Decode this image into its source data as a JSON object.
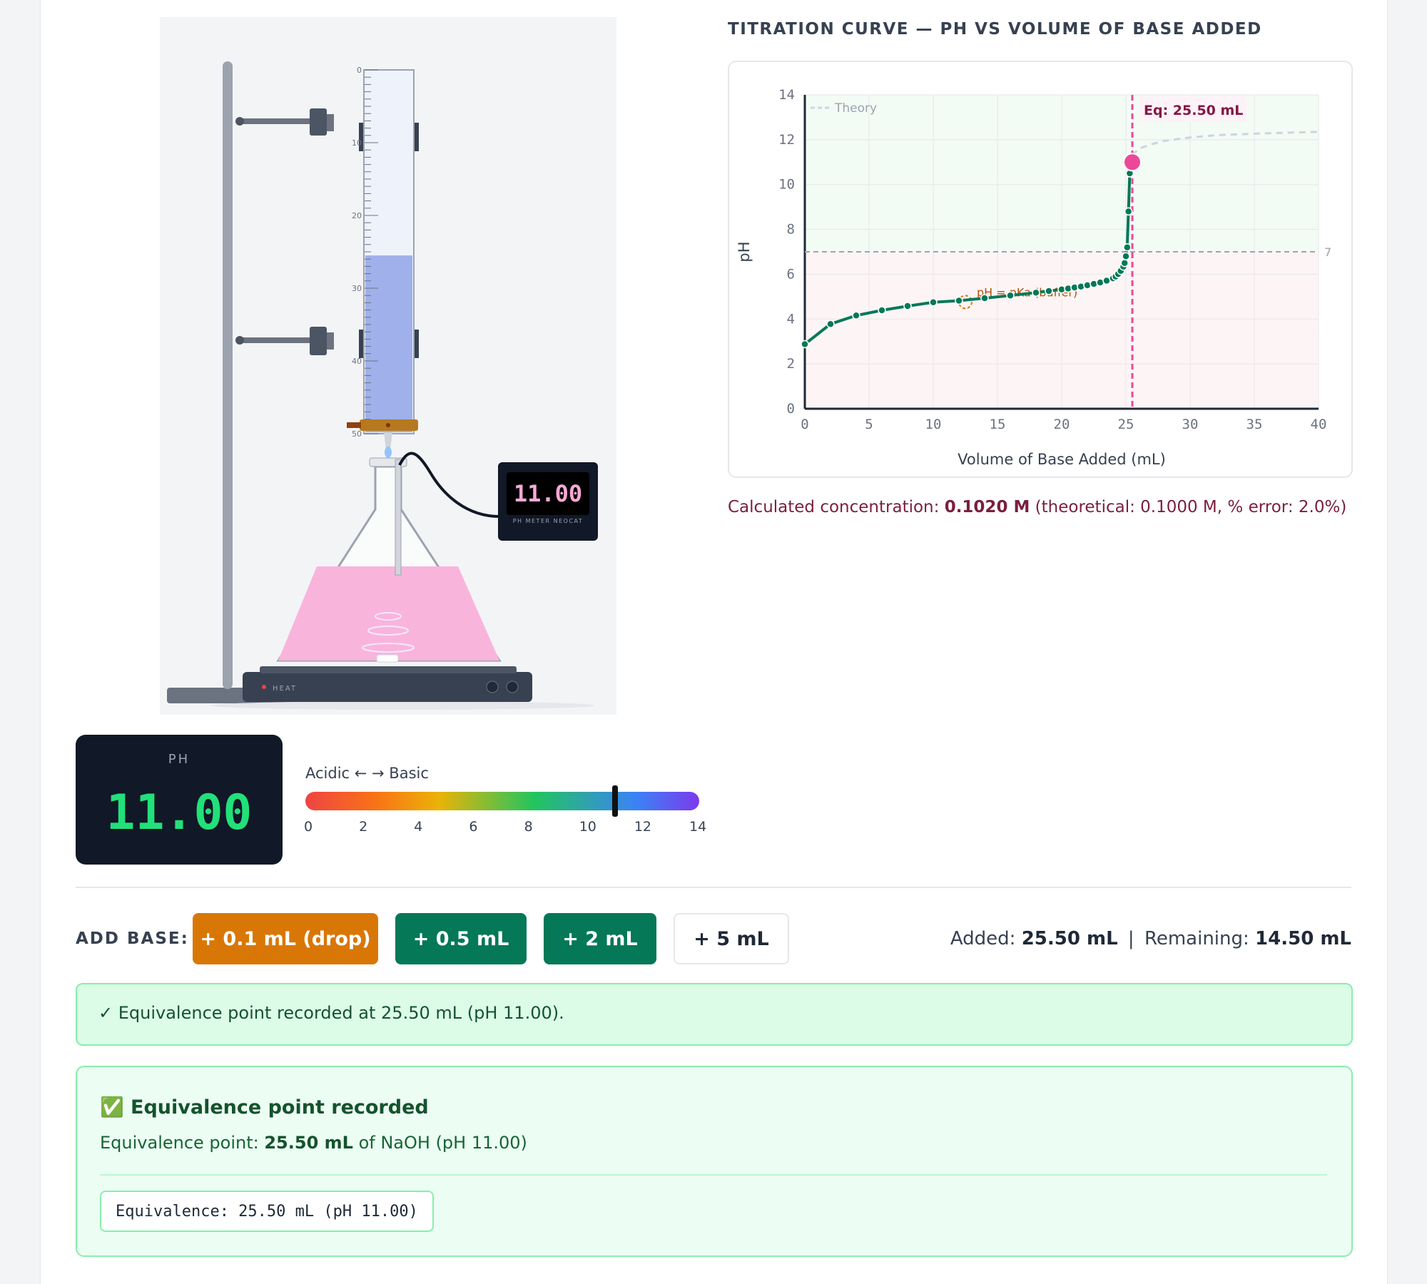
{
  "chart_title": "TITRATION CURVE — PH VS VOLUME OF BASE ADDED",
  "meter": {
    "reading": "11.00",
    "label": "PH METER NEOCAT"
  },
  "hotplate": {
    "label": "HEAT"
  },
  "burette": {
    "ticks": [
      "0",
      "10",
      "20",
      "30",
      "40",
      "50"
    ],
    "level_fraction": 0.51
  },
  "chart_data": {
    "type": "line",
    "xlabel": "Volume of Base Added (mL)",
    "ylabel": "pH",
    "xlim": [
      0,
      40
    ],
    "ylim": [
      0,
      14
    ],
    "xticks": [
      "0",
      "5",
      "10",
      "15",
      "20",
      "25",
      "30",
      "35",
      "40"
    ],
    "yticks": [
      "0",
      "2",
      "4",
      "6",
      "8",
      "10",
      "12",
      "14"
    ],
    "legend": "Theory",
    "reference_line": {
      "value": 7,
      "label": "7"
    },
    "equivalence": {
      "x": 25.5,
      "y": 11.0,
      "label": "Eq: 25.50 mL"
    },
    "half_equivalence": {
      "x": 12.5,
      "y": 4.76,
      "label": "pH = pKa (buffer)"
    },
    "measured": {
      "x": [
        0,
        2,
        4,
        6,
        8,
        10,
        12,
        14,
        16,
        18,
        19,
        20,
        20.5,
        21,
        21.5,
        22,
        22.5,
        23,
        23.5,
        24,
        24.2,
        24.4,
        24.6,
        24.8,
        24.9,
        25.0,
        25.1,
        25.2,
        25.3,
        25.5
      ],
      "y": [
        2.88,
        3.78,
        4.16,
        4.39,
        4.58,
        4.75,
        4.82,
        4.93,
        5.05,
        5.18,
        5.25,
        5.32,
        5.36,
        5.41,
        5.45,
        5.51,
        5.57,
        5.63,
        5.71,
        5.82,
        5.9,
        6.01,
        6.15,
        6.34,
        6.5,
        6.8,
        7.2,
        8.8,
        10.5,
        11.0
      ],
      "color": "#047857"
    },
    "theory": {
      "x": [
        25.5,
        26,
        27,
        28,
        30,
        32,
        35,
        38,
        40
      ],
      "y": [
        11.3,
        11.6,
        11.8,
        11.95,
        12.1,
        12.2,
        12.27,
        12.32,
        12.35
      ],
      "color": "#cbd5e1"
    }
  },
  "calc": {
    "prefix": "Calculated concentration:",
    "value": "0.1020 M",
    "suffix": "(theoretical: 0.1000 M, % error: 2.0%)"
  },
  "ph_panel": {
    "label": "PH",
    "value": "11.00"
  },
  "scale": {
    "label": "Acidic ← → Basic",
    "ticks": [
      "0",
      "2",
      "4",
      "6",
      "8",
      "10",
      "12",
      "14"
    ],
    "marker_value": 11.0
  },
  "add_base": {
    "label": "ADD BASE:",
    "buttons": [
      "+ 0.1 mL (drop)",
      "+ 0.5 mL",
      "+ 2 mL",
      "+ 5 mL"
    ]
  },
  "status": {
    "added_label": "Added:",
    "added_value": "25.50 mL",
    "sep": "|",
    "remaining_label": "Remaining:",
    "remaining_value": "14.50 mL"
  },
  "alert": "✓ Equivalence point recorded at 25.50 mL (pH 11.00).",
  "result": {
    "title": "✅ Equivalence point recorded",
    "line_prefix": "Equivalence point:",
    "line_value": "25.50 mL",
    "line_suffix": "of NaOH (pH 11.00)",
    "code": "Equivalence: 25.50 mL (pH 11.00)"
  },
  "colors": {
    "accent_green": "#047857",
    "accent_orange": "#d97706",
    "eq_pink": "#ec4899",
    "flask_pink": "#f9b4dc"
  }
}
